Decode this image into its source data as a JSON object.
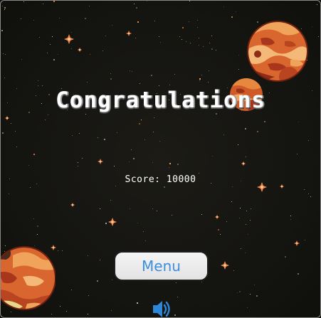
{
  "game": {
    "title": "Congratulations",
    "score_text": "Score: 10000",
    "menu_label": "Menu"
  },
  "icons": {
    "sound": "speaker-volume-icon"
  },
  "colors": {
    "background": "#141410",
    "title_text": "#ffffff",
    "button_text": "#3b8fe0",
    "button_fill": "#efefef",
    "speaker": "#2f86d6",
    "planet_base": "#d9662e",
    "star": "#f0874a"
  }
}
